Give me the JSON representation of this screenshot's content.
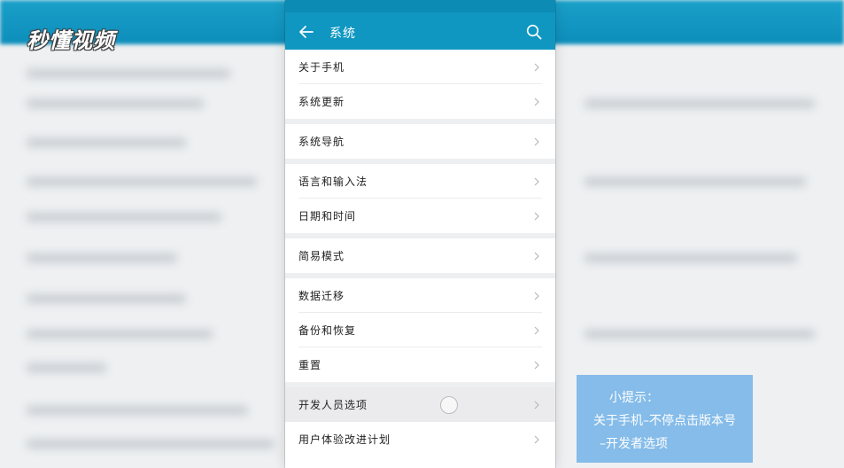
{
  "watermark": {
    "text": "秒懂视频"
  },
  "appbar": {
    "title": "系统",
    "back_icon": "arrow-left-icon",
    "search_icon": "search-icon"
  },
  "groups": [
    {
      "items": [
        {
          "label": "关于手机"
        },
        {
          "label": "系统更新"
        }
      ]
    },
    {
      "items": [
        {
          "label": "系统导航"
        }
      ]
    },
    {
      "items": [
        {
          "label": "语言和输入法"
        },
        {
          "label": "日期和时间"
        }
      ]
    },
    {
      "items": [
        {
          "label": "简易模式"
        }
      ]
    },
    {
      "items": [
        {
          "label": "数据迁移"
        },
        {
          "label": "备份和恢复"
        },
        {
          "label": "重置"
        }
      ]
    },
    {
      "items": [
        {
          "label": "开发人员选项",
          "pressed": true
        },
        {
          "label": "用户体验改进计划"
        }
      ]
    }
  ],
  "tip": {
    "line1": "小提示：",
    "line2": "关于手机–不停点击版本号",
    "line3": "–开发者选项"
  },
  "colors": {
    "appbar": "#0f97c2",
    "tip_bg": "#7db8e8",
    "divider": "#ececec"
  }
}
